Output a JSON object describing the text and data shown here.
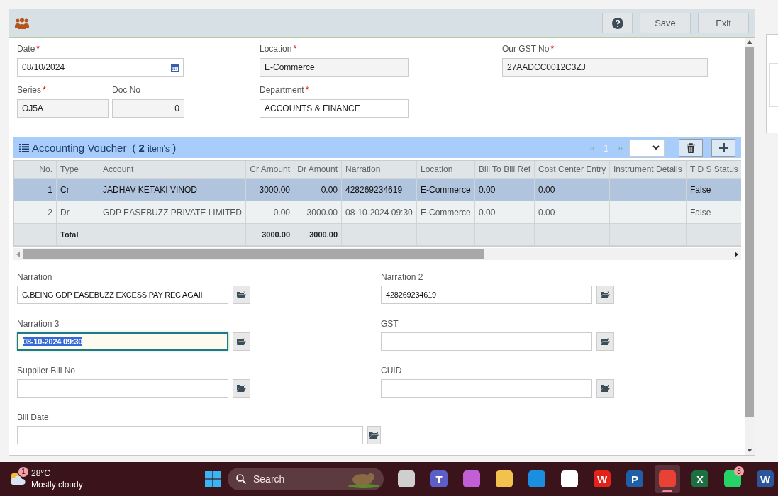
{
  "toolbar": {
    "buttons": [
      {
        "kind": "help"
      },
      {
        "kind": "text",
        "label": "Save"
      },
      {
        "kind": "text",
        "label": "Exit"
      }
    ]
  },
  "required_mark": "*",
  "header_fields": {
    "date": {
      "label": "Date",
      "required": true,
      "value": "08/10/2024"
    },
    "location": {
      "label": "Location",
      "required": true,
      "value": "E-Commerce"
    },
    "gst_no": {
      "label": "Our GST No",
      "required": true,
      "value": "27AADCC0012C3ZJ"
    },
    "series": {
      "label": "Series",
      "required": true,
      "value": "OJ5A"
    },
    "doc_no": {
      "label": "Doc No",
      "required": false,
      "value": "0"
    },
    "department": {
      "label": "Department",
      "required": true,
      "value": "ACCOUNTS & FINANCE"
    }
  },
  "grid": {
    "title": "Accounting Voucher",
    "open": "(",
    "count": "2",
    "unit": "item's",
    "close": ")",
    "pager": {
      "prev": "«",
      "page": "1",
      "next": "»"
    },
    "columns": [
      "No.",
      "Type",
      "Account",
      "Cr Amount",
      "Dr Amount",
      "Narration",
      "Location",
      "Bill To Bill Ref",
      "Cost Center Entry",
      "Instrument Details",
      "T D S Status"
    ],
    "rows": [
      {
        "selected": true,
        "cells": [
          "1",
          "Cr",
          "JADHAV KETAKI VINOD",
          "3000.00",
          "0.00",
          "428269234619",
          "E-Commerce",
          "0.00",
          "0.00",
          "",
          "False"
        ]
      },
      {
        "selected": false,
        "cells": [
          "2",
          "Dr",
          "GDP EASEBUZZ PRIVATE LIMITED",
          "0.00",
          "3000.00",
          "08-10-2024 09:30",
          "E-Commerce",
          "0.00",
          "0.00",
          "",
          "False"
        ]
      }
    ],
    "total": {
      "label": "Total",
      "cr": "3000.00",
      "dr": "3000.00"
    }
  },
  "detail_fields": [
    {
      "label": "Narration",
      "value": "G.BEING GDP EASEBUZZ EXCESS PAY REC AGAII",
      "focused": false
    },
    {
      "label": "Narration 2",
      "value": "428269234619",
      "focused": false
    },
    {
      "label": "Narration 3",
      "value": "08-10-2024 09:30",
      "focused": true
    },
    {
      "label": "GST",
      "focused": false
    },
    {
      "label": "Supplier Bill No",
      "focused": false
    },
    {
      "label": "CUID",
      "focused": false
    },
    {
      "label": "Bill Date",
      "focused": false
    }
  ],
  "taskbar": {
    "weather": {
      "badge": "1",
      "temperature": "28°C",
      "condition": "Mostly cloudy"
    },
    "search": {
      "placeholder": "Search"
    },
    "apps": [
      {
        "kind": "task-view",
        "active": false
      },
      {
        "kind": "teams",
        "active": false,
        "glyph": "T"
      },
      {
        "kind": "copilot",
        "active": false
      },
      {
        "kind": "folder",
        "active": false
      },
      {
        "kind": "edge",
        "active": false
      },
      {
        "kind": "store",
        "active": false
      },
      {
        "kind": "wps",
        "active": false,
        "glyph": "W"
      },
      {
        "kind": "p-app",
        "active": false,
        "glyph": "P"
      },
      {
        "kind": "chrome",
        "active": true
      },
      {
        "kind": "excel",
        "active": false,
        "glyph": "X"
      },
      {
        "kind": "whatsapp",
        "active": false,
        "badge": "8"
      },
      {
        "kind": "word",
        "active": false,
        "glyph": "W"
      }
    ]
  }
}
